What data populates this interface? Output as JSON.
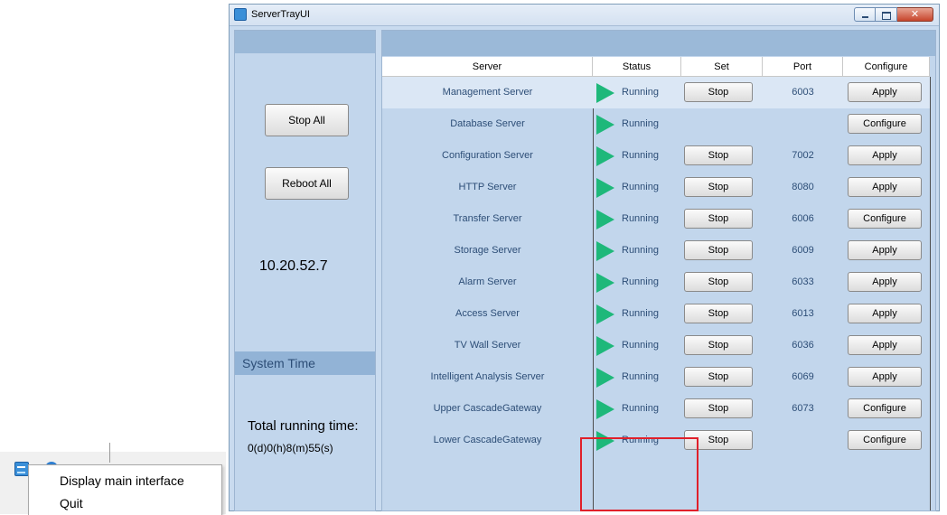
{
  "tray_menu": {
    "items": [
      "Display main interface",
      "Quit"
    ]
  },
  "window": {
    "title": "ServerTrayUI",
    "controls": {
      "close_glyph": "✕"
    }
  },
  "left_panel": {
    "stop_all_label": "Stop All",
    "reboot_all_label": "Reboot All",
    "ip_address": "10.20.52.7",
    "system_time_header": "System Time",
    "total_running_label": "Total running time:",
    "total_running_value": "0(d)0(h)8(m)55(s)"
  },
  "table": {
    "columns": [
      "Server",
      "Status",
      "Set",
      "Port",
      "Configure"
    ],
    "rows": [
      {
        "server": "Management Server",
        "status": "Running",
        "set": "Stop",
        "port": "6003",
        "configure": "Apply",
        "selected": true
      },
      {
        "server": "Database Server",
        "status": "Running",
        "set": "",
        "port": "",
        "configure": "Configure"
      },
      {
        "server": "Configuration Server",
        "status": "Running",
        "set": "Stop",
        "port": "7002",
        "configure": "Apply"
      },
      {
        "server": "HTTP Server",
        "status": "Running",
        "set": "Stop",
        "port": "8080",
        "configure": "Apply"
      },
      {
        "server": "Transfer Server",
        "status": "Running",
        "set": "Stop",
        "port": "6006",
        "configure": "Configure"
      },
      {
        "server": "Storage Server",
        "status": "Running",
        "set": "Stop",
        "port": "6009",
        "configure": "Apply"
      },
      {
        "server": "Alarm Server",
        "status": "Running",
        "set": "Stop",
        "port": "6033",
        "configure": "Apply"
      },
      {
        "server": "Access Server",
        "status": "Running",
        "set": "Stop",
        "port": "6013",
        "configure": "Apply"
      },
      {
        "server": "TV Wall Server",
        "status": "Running",
        "set": "Stop",
        "port": "6036",
        "configure": "Apply"
      },
      {
        "server": "Intelligent Analysis Server",
        "status": "Running",
        "set": "Stop",
        "port": "6069",
        "configure": "Apply"
      },
      {
        "server": "Upper CascadeGateway",
        "status": "Running",
        "set": "Stop",
        "port": "6073",
        "configure": "Configure",
        "highlight": true
      },
      {
        "server": "Lower CascadeGateway",
        "status": "Running",
        "set": "Stop",
        "port": "",
        "configure": "Configure",
        "highlight": true
      }
    ]
  },
  "colors": {
    "running_icon": "#1eb87a",
    "highlight_border": "#e0202a",
    "panel_background": "#c2d6ec",
    "text_blue": "#2d4e77"
  },
  "icons": {
    "status": "play-triangle-icon",
    "app": "server-tray-app-icon"
  }
}
